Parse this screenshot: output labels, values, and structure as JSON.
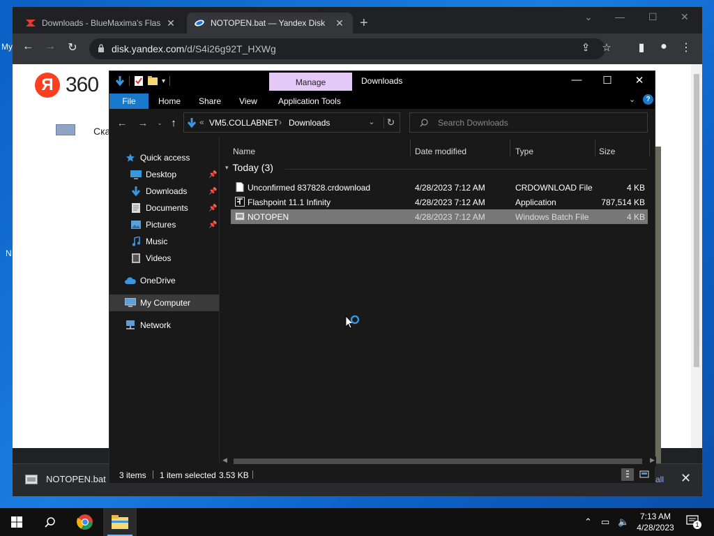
{
  "desktop": {
    "frag_left_1": "My",
    "frag_left_2": "N"
  },
  "browser": {
    "tabs": [
      {
        "title": "Downloads - BlueMaxima's Flashp",
        "active": false
      },
      {
        "title": "NOTOPEN.bat — Yandex Disk",
        "active": true
      }
    ],
    "new_tab_label": "+",
    "url_host": "disk.yandex.com",
    "url_path": "/d/S4i26g92T_HXWg",
    "page": {
      "logo_letter": "Я",
      "logo_text": "360",
      "frag_text": "Ска"
    },
    "download_bar": {
      "item_name": "NOTOPEN.bat",
      "show_all": "all"
    }
  },
  "explorer": {
    "context_tab": "Manage",
    "title": "Downloads",
    "ribbon_tabs": [
      "File",
      "Home",
      "Share",
      "View",
      "Application Tools"
    ],
    "address": {
      "overflow": "«",
      "root": "VM5.COLLABNET",
      "current": "Downloads"
    },
    "search_placeholder": "Search Downloads",
    "nav": [
      {
        "label": "Quick access",
        "icon": "star-icon"
      },
      {
        "label": "Desktop",
        "icon": "desktop-icon",
        "pinned": true
      },
      {
        "label": "Downloads",
        "icon": "download-folder-icon",
        "pinned": true
      },
      {
        "label": "Documents",
        "icon": "documents-icon",
        "pinned": true
      },
      {
        "label": "Pictures",
        "icon": "pictures-icon",
        "pinned": true
      },
      {
        "label": "Music",
        "icon": "music-icon"
      },
      {
        "label": "Videos",
        "icon": "videos-icon"
      },
      {
        "label": "OneDrive",
        "icon": "onedrive-icon"
      },
      {
        "label": "My Computer",
        "icon": "computer-icon",
        "selected": true
      },
      {
        "label": "Network",
        "icon": "network-icon"
      }
    ],
    "columns": {
      "name": "Name",
      "date": "Date modified",
      "type": "Type",
      "size": "Size"
    },
    "group_label": "Today (3)",
    "files": [
      {
        "name": "Unconfirmed 837828.crdownload",
        "date": "4/28/2023 7:12 AM",
        "type": "CRDOWNLOAD File",
        "size": "4 KB",
        "selected": false
      },
      {
        "name": "Flashpoint 11.1 Infinity",
        "date": "4/28/2023 7:12 AM",
        "type": "Application",
        "size": "787,514 KB",
        "selected": false
      },
      {
        "name": "NOTOPEN",
        "date": "4/28/2023 7:12 AM",
        "type": "Windows Batch File",
        "size": "4 KB",
        "selected": true
      }
    ],
    "status": {
      "items": "3 items",
      "selected": "1 item selected",
      "size": "3.53 KB"
    }
  },
  "taskbar": {
    "time": "7:13 AM",
    "date": "4/28/2023",
    "notifications": "1"
  }
}
